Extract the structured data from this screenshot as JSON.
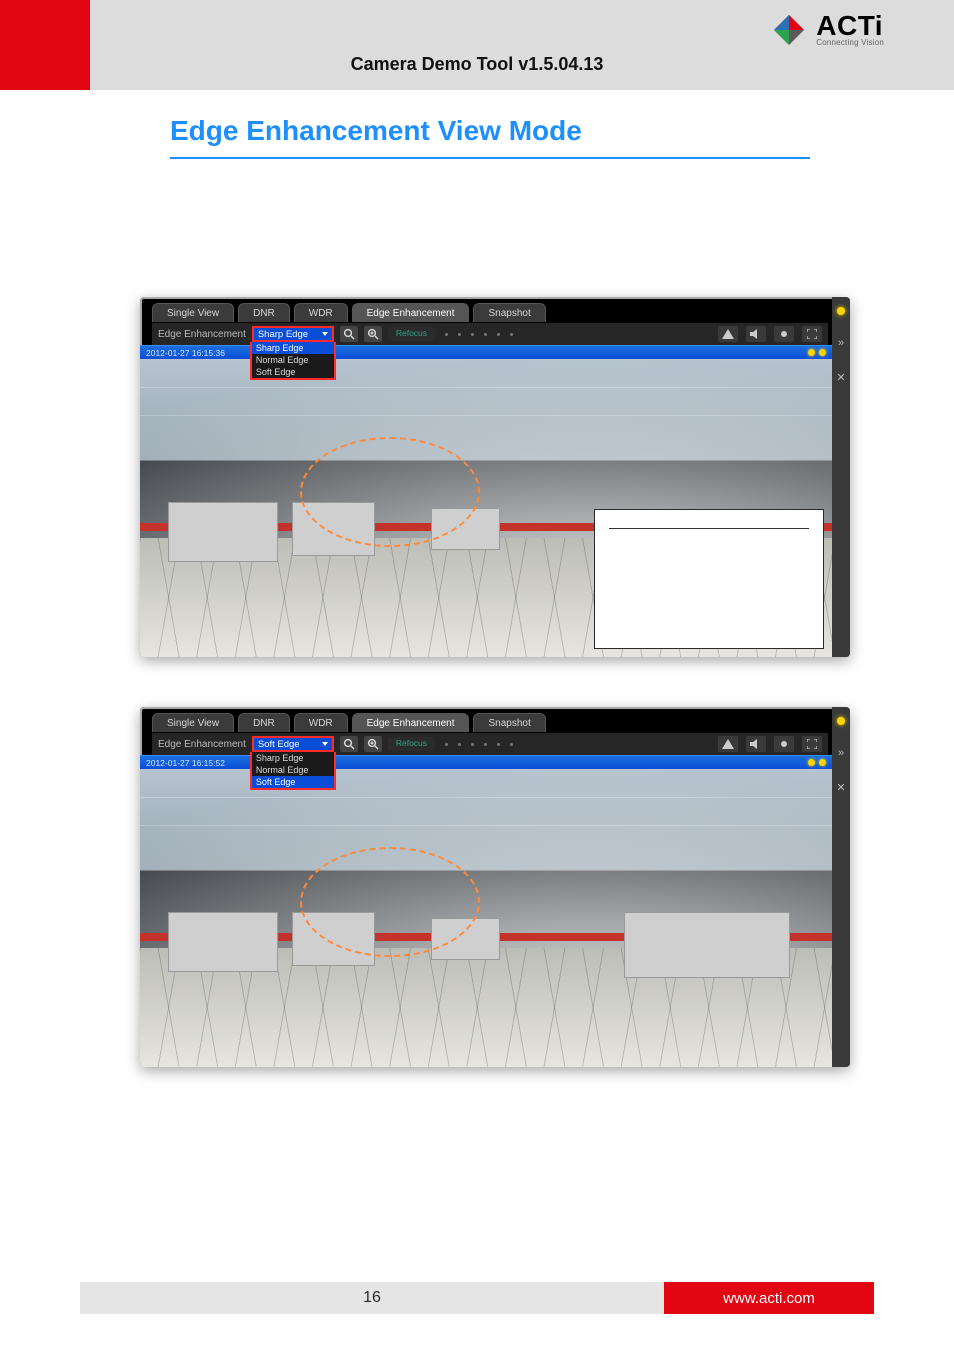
{
  "header": {
    "title": "Camera Demo Tool v1.5.04.13",
    "logo_name": "ACTi",
    "logo_tagline": "Connecting Vision"
  },
  "section": {
    "title": "Edge Enhancement View Mode"
  },
  "tabs": [
    "Single View",
    "DNR",
    "WDR",
    "Edge Enhancement",
    "Snapshot"
  ],
  "active_tab_index": 3,
  "controls": {
    "label": "Edge Enhancement",
    "refocus": "Refocus"
  },
  "dropdown_options": [
    "Sharp Edge",
    "Normal Edge",
    "Soft Edge"
  ],
  "screenshots": [
    {
      "selected_option": "Sharp Edge",
      "highlighted_option": "Sharp Edge",
      "timestamp": "2012-01-27  16:15:36",
      "has_callout": true
    },
    {
      "selected_option": "Soft Edge",
      "highlighted_option": "Soft Edge",
      "timestamp": "2012-01-27  16:15:52",
      "has_callout": false
    }
  ],
  "footer": {
    "page_number": "16",
    "url": "www.acti.com"
  }
}
